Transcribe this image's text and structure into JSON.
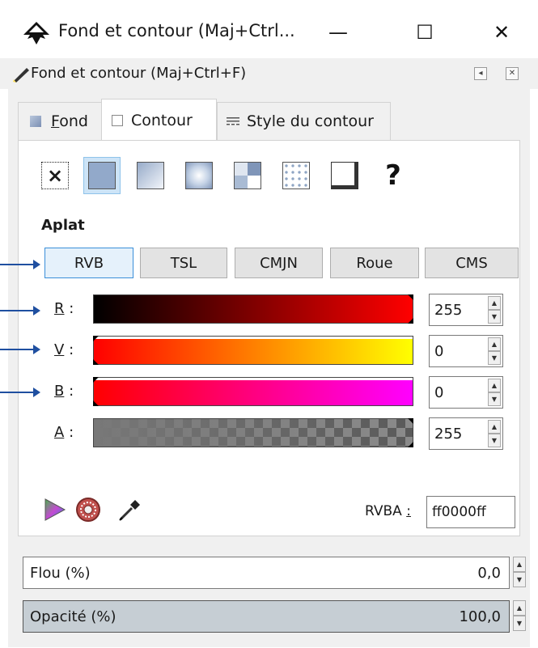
{
  "window": {
    "title": "Fond et contour (Maj+Ctrl...",
    "minimize": "—",
    "maximize": "☐",
    "close": "✕"
  },
  "panel": {
    "title": "Fond et contour (Maj+Ctrl+F)"
  },
  "tabs": [
    {
      "pre": "",
      "u": "F",
      "post": "ond"
    },
    {
      "label": "Contour"
    },
    {
      "label": "Style du contour"
    }
  ],
  "paint_types": {
    "unset": "?",
    "none": "×"
  },
  "section_title": "Aplat",
  "modes": [
    "RVB",
    "TSL",
    "CMJN",
    "Roue",
    "CMS"
  ],
  "channels": [
    {
      "u": "R",
      "rest": ":",
      "value": "255"
    },
    {
      "u": "V",
      "rest": ":",
      "value": "0"
    },
    {
      "u": "B",
      "rest": ":",
      "value": "0"
    },
    {
      "u": "A",
      "rest": ":",
      "value": "255"
    }
  ],
  "rgba": {
    "label_pre": "RVBA ",
    "label_u": ":",
    "value": "ff0000ff"
  },
  "blur": {
    "label": "Flou (%)",
    "value": "0,0"
  },
  "opacity": {
    "label": "Opacité (%)",
    "value": "100,0"
  },
  "colors": {
    "current": "#ff0000",
    "accent": "#3a8fd9",
    "pointer": "#1f4fa0"
  }
}
